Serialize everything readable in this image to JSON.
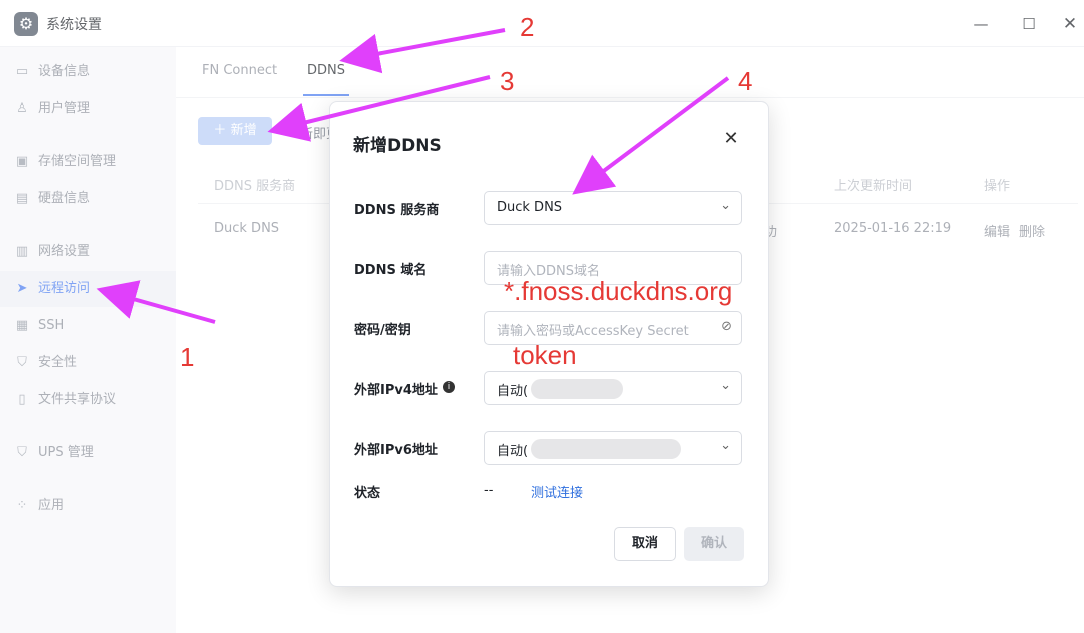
{
  "window": {
    "title": "系统设置",
    "app_icon": "gear-icon"
  },
  "sidebar": {
    "items": [
      {
        "label": "设备信息",
        "icon": "monitor-icon"
      },
      {
        "label": "用户管理",
        "icon": "user-icon"
      },
      {
        "label": "存储空间管理",
        "icon": "storage-icon"
      },
      {
        "label": "硬盘信息",
        "icon": "disk-icon"
      },
      {
        "label": "网络设置",
        "icon": "network-icon"
      },
      {
        "label": "远程访问",
        "icon": "send-icon",
        "active": true
      },
      {
        "label": "SSH",
        "icon": "terminal-icon"
      },
      {
        "label": "安全性",
        "icon": "shield-icon"
      },
      {
        "label": "文件共享协议",
        "icon": "file-icon"
      },
      {
        "label": "UPS 管理",
        "icon": "ups-shield-icon"
      },
      {
        "label": "应用",
        "icon": "apps-icon"
      }
    ]
  },
  "tabs": [
    {
      "label": "FN Connect"
    },
    {
      "label": "DDNS",
      "active": true
    }
  ],
  "toolbar": {
    "add_label": "新增",
    "refresh_partial": "新即更"
  },
  "table": {
    "headers": {
      "provider": "DDNS 服务商",
      "last_update": "上次更新时间",
      "actions": "操作"
    },
    "rows": [
      {
        "provider": "Duck DNS",
        "status_partial": "功",
        "last_update": "2025-01-16 22:19",
        "edit": "编辑",
        "delete": "删除"
      }
    ]
  },
  "modal": {
    "title": "新增DDNS",
    "fields": {
      "provider_label": "DDNS 服务商",
      "provider_value": "Duck DNS",
      "domain_label": "DDNS 域名",
      "domain_placeholder": "请输入DDNS域名",
      "password_label": "密码/密钥",
      "password_placeholder": "请输入密码或AccessKey Secret",
      "ipv4_label": "外部IPv4地址",
      "ipv4_value": "自动(",
      "ipv6_label": "外部IPv6地址",
      "ipv6_value": "自动(",
      "status_label": "状态",
      "status_value": "--",
      "test_link": "测试连接"
    },
    "cancel_label": "取消",
    "confirm_label": "确认"
  },
  "annotations": {
    "num1": "1",
    "num2": "2",
    "num3": "3",
    "num4": "4",
    "domain_hint": "*.fnoss.duckdns.org",
    "token_hint": "token"
  },
  "colors": {
    "accent": "#4a7cf0",
    "annotation_red": "#e53935",
    "arrow_magenta": "#e040fb"
  }
}
